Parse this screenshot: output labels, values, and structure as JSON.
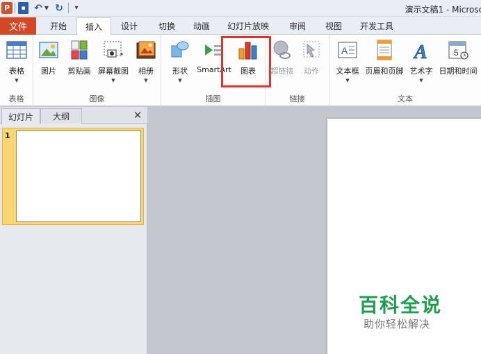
{
  "window": {
    "title": "演示文稿1 - Microso",
    "app_icon_text": "P"
  },
  "quick_access": {
    "save_icon": "save-icon",
    "undo_icon": "undo-icon",
    "redo_icon": "redo-icon",
    "customize_icon": "dropdown-icon"
  },
  "tabs": {
    "file": "文件",
    "items": [
      "开始",
      "插入",
      "设计",
      "切换",
      "动画",
      "幻灯片放映",
      "审阅",
      "视图",
      "开发工具"
    ],
    "active": "插入"
  },
  "ribbon": {
    "groups": {
      "tables": {
        "label": "表格",
        "buttons": [
          {
            "label": "表格",
            "icon": "table-icon",
            "has_dropdown": true
          }
        ]
      },
      "images": {
        "label": "图像",
        "buttons": [
          {
            "label": "图片",
            "icon": "picture-icon",
            "has_dropdown": false
          },
          {
            "label": "剪贴画",
            "icon": "clipart-icon",
            "has_dropdown": false
          },
          {
            "label": "屏幕截图",
            "icon": "screenshot-icon",
            "has_dropdown": true
          },
          {
            "label": "相册",
            "icon": "photo-album-icon",
            "has_dropdown": true
          }
        ]
      },
      "illustrations": {
        "label": "插图",
        "buttons": [
          {
            "label": "形状",
            "icon": "shapes-icon",
            "has_dropdown": true
          },
          {
            "label": "SmartArt",
            "icon": "smartart-icon",
            "has_dropdown": false
          },
          {
            "label": "图表",
            "icon": "chart-icon",
            "has_dropdown": false,
            "highlighted": true
          }
        ]
      },
      "links": {
        "label": "链接",
        "buttons": [
          {
            "label": "超链接",
            "icon": "hyperlink-icon",
            "disabled": true
          },
          {
            "label": "动作",
            "icon": "action-icon",
            "disabled": true
          }
        ]
      },
      "text": {
        "label": "文本",
        "buttons": [
          {
            "label": "文本框",
            "icon": "textbox-icon",
            "has_dropdown": true
          },
          {
            "label": "页眉和页脚",
            "icon": "header-footer-icon",
            "has_dropdown": false
          },
          {
            "label": "艺术字",
            "icon": "wordart-icon",
            "has_dropdown": true
          },
          {
            "label": "日期和时间",
            "icon": "date-time-icon",
            "has_dropdown": false
          }
        ]
      }
    },
    "highlight_color": "#e2342f"
  },
  "slide_panel": {
    "tabs": [
      "幻灯片",
      "大纲"
    ],
    "active_tab": "幻灯片",
    "close_icon": "close-icon",
    "slides": [
      {
        "number": "1"
      }
    ]
  },
  "watermark": {
    "title": "百科全说",
    "subtitle": "助你轻松解决",
    "color": "#1e9d50"
  },
  "colors": {
    "file_tab": "#d24726",
    "selected_slide": "#f9d66f"
  }
}
